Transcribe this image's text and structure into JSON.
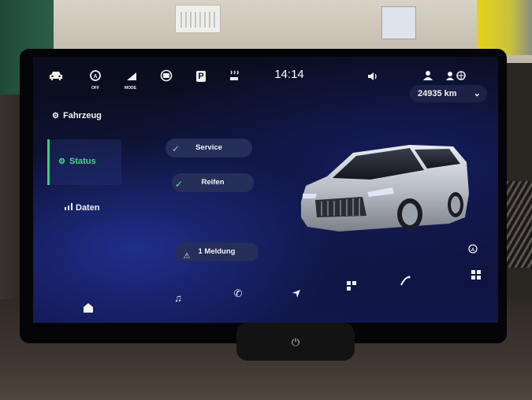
{
  "topbar": {
    "icons": [
      "car-icon",
      "auto-start-stop-icon",
      "drive-mode-icon",
      "camera-icon",
      "parking-icon",
      "heated-seat-icon"
    ],
    "mode_label": "MODE",
    "off_label": "OFF",
    "parking_label": "P",
    "time": "14:14",
    "right_icons": [
      "speaker-icon",
      "profile-icon",
      "connectivity-icon"
    ]
  },
  "odometer": {
    "value": "24935 km"
  },
  "sidebar": {
    "items": [
      {
        "label": "Fahrzeug",
        "icon": "car-settings-icon",
        "active": false
      },
      {
        "label": "Status",
        "icon": "car-status-icon",
        "active": true
      },
      {
        "label": "Daten",
        "icon": "data-bars-icon",
        "active": false
      }
    ]
  },
  "status": {
    "service_label": "Service",
    "tires_label": "Reifen",
    "message_label": "1 Meldung"
  },
  "dock": {
    "icons": [
      "home-icon",
      "music-icon",
      "phone-icon",
      "navigation-icon",
      "apps-icon",
      "assist-icon",
      "grid-icon"
    ]
  },
  "colors": {
    "accent": "#3ddc86",
    "pill": "#262e5a",
    "screen_bg": "#0d1130"
  }
}
